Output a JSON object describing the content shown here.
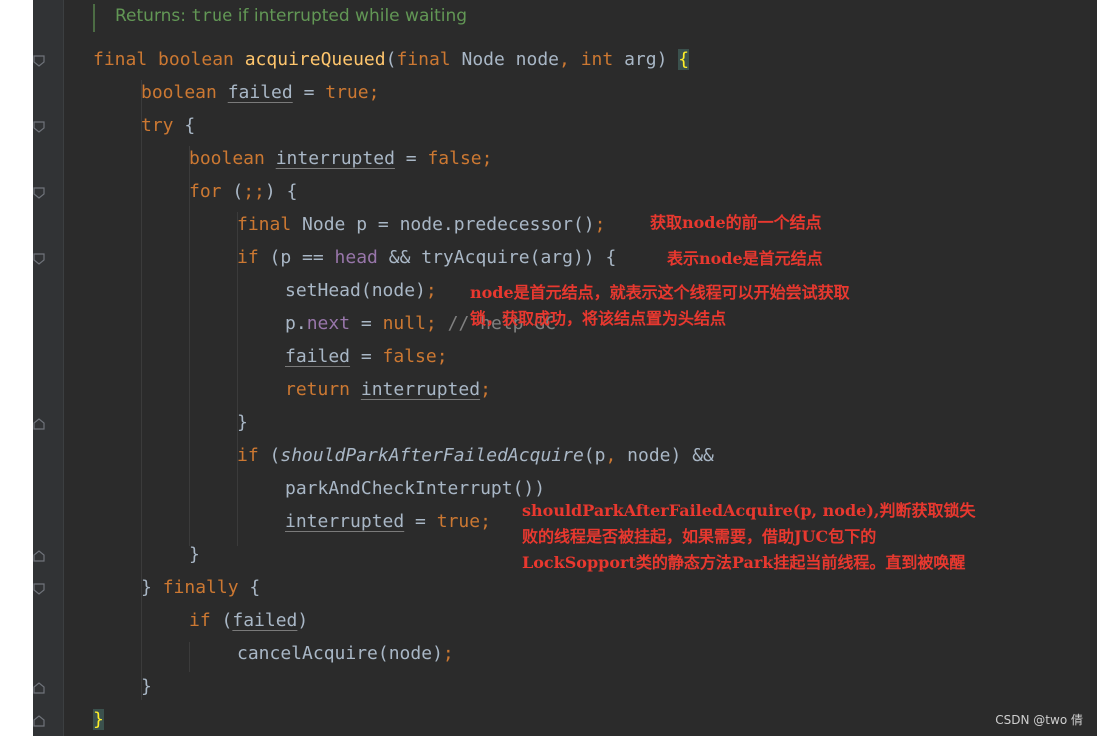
{
  "doc": {
    "prefix": "Returns: ",
    "code": "true",
    "suffix": " if interrupted while waiting"
  },
  "code": {
    "l1": {
      "kw1": "final boolean ",
      "fn": "acquireQueued",
      "p1": "(",
      "kw2": "final ",
      "t1": "Node node",
      "c1": ", ",
      "kw3": "int ",
      "t2": "arg) ",
      "b": "{"
    },
    "l2": {
      "kw": "boolean ",
      "v": "failed",
      "eq": " = ",
      "val": "true",
      "sc": ";"
    },
    "l3": {
      "kw": "try ",
      "t": "{"
    },
    "l4": {
      "kw": "boolean ",
      "v": "interrupted",
      "eq": " = ",
      "val": "false",
      "sc": ";"
    },
    "l5": {
      "kw": "for ",
      "t1": "(",
      "s1": ";;",
      "t2": ") {"
    },
    "l6": {
      "kw": "final ",
      "t": "Node p = node.predecessor()",
      "sc": ";"
    },
    "l7": {
      "kw": "if ",
      "t1": "(p == ",
      "f": "head",
      "t2": " && tryAcquire(arg)) {"
    },
    "l8": {
      "t": "setHead(node)",
      "sc": ";"
    },
    "l9": {
      "t1": "p.",
      "f": "next",
      "t2": " = ",
      "kw": "null",
      "sc": ";",
      "cm": " // help GC"
    },
    "l10": {
      "v": "failed",
      "eq": " = ",
      "val": "false",
      "sc": ";"
    },
    "l11": {
      "kw": "return ",
      "v": "interrupted",
      "sc": ";"
    },
    "l12": {
      "t": "}"
    },
    "l13": {
      "kw": "if ",
      "t1": "(",
      "m": "shouldParkAfterFailedAcquire",
      "t2": "(p",
      "c": ", ",
      "t3": "node) &&"
    },
    "l14": {
      "t": "parkAndCheckInterrupt())"
    },
    "l15": {
      "v": "interrupted",
      "eq": " = ",
      "val": "true",
      "sc": ";"
    },
    "l16": {
      "t": "}"
    },
    "l17": {
      "t1": "} ",
      "kw": "finally",
      "t2": " {"
    },
    "l18": {
      "kw": "if ",
      "t1": "(",
      "v": "failed",
      "t2": ")"
    },
    "l19": {
      "t": "cancelAcquire(node)",
      "sc": ";"
    },
    "l20": {
      "t": "}"
    },
    "l21": {
      "t": "}"
    }
  },
  "annotations": {
    "a1": "获取node的前一个结点",
    "a2": "表示node是首元结点",
    "a3_line1": "node是首元结点，就表示这个线程可以开始尝试获取",
    "a3_line2": "锁，获取成功，将该结点置为头结点",
    "a4_line1": "shouldParkAfterFailedAcquire(p, node),判断获取锁失",
    "a4_line2": "败的线程是否被挂起，如果需要，借助JUC包下的",
    "a4_line3": "LockSopport类的静态方法Park挂起当前线程。直到被唤醒"
  },
  "watermark": "CSDN @two 倩",
  "colors": {
    "background": "#2b2b2b",
    "keyword": "#cc7832",
    "method": "#ffc66d",
    "field": "#9876aa",
    "doc": "#629755",
    "annotation": "#e8382f"
  }
}
